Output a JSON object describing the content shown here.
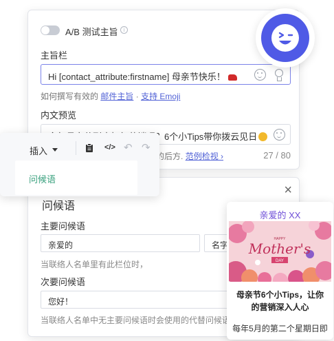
{
  "ab_test": {
    "label": "A/B 测试主旨",
    "info": "i"
  },
  "subject": {
    "label": "主旨栏",
    "value": "Hi [contact_attribute:firstname] 母亲节快乐！",
    "help_prefix": "如何撰写有效的",
    "help_link_1": "邮件主旨",
    "help_sep": "·",
    "help_link_2": "支持 Emoji"
  },
  "preview": {
    "label": "内文预览",
    "value": "今年母亲节到底如何营销呢？6个小Tips带你拨云见日",
    "note_prefix": "的后方.",
    "note_link": "范例检视 ›",
    "counter": "27 / 80"
  },
  "toolbar": {
    "insert_label": "插入",
    "menu_item": "问候语",
    "icons": [
      "clipboard-icon",
      "code-icon",
      "undo-icon",
      "redo-icon"
    ]
  },
  "greeting": {
    "title": "问候语",
    "primary_label": "主要问候语",
    "primary_value": "亲爱的",
    "primary_secondary_value": "名字",
    "primary_hint": "当联络人名单里有此栏位时，",
    "secondary_label": "次要问候语",
    "secondary_value": "您好！",
    "secondary_hint": "当联络人名单中无主要问候语时会使用的代替问候语"
  },
  "mothers_day_card": {
    "greeting": "亲爱的 XX",
    "image_small_text": "HAPPY",
    "image_script_text": "Mother's",
    "image_day_text": "DAY",
    "title_line1": "母亲节6个小Tips，让你",
    "title_line2": "的营销深入人心",
    "footer": "每年5月的第二个星期日即"
  },
  "colors": {
    "accent": "#4f5ae6",
    "link": "#5061d6",
    "menu_green": "#3aa17e",
    "brand_purple": "#6f4fd8"
  }
}
